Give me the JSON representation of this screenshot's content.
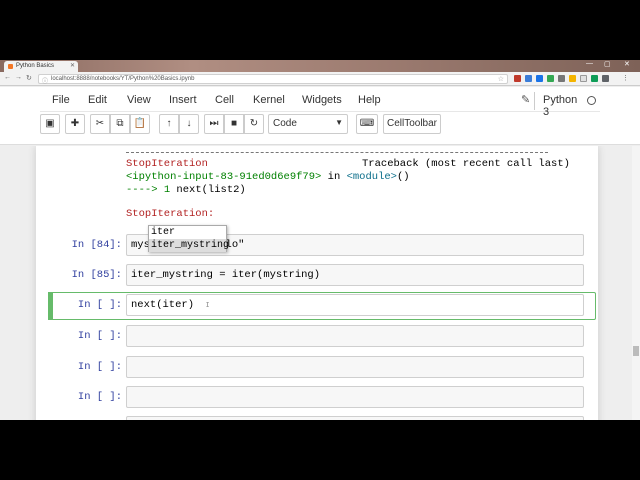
{
  "browser": {
    "tab_title": "Python Basics",
    "address": "localhost:8888/notebooks/YT/Python%20Basics.ipynb",
    "win_minimize": "—",
    "win_maximize": "▢",
    "win_close": "✕"
  },
  "menu": {
    "items": [
      "File",
      "Edit",
      "View",
      "Insert",
      "Cell",
      "Kernel",
      "Widgets",
      "Help"
    ],
    "kernel_name": "Python 3"
  },
  "toolbar": {
    "cell_type": "Code",
    "celltoolbar_label": "CellToolbar"
  },
  "traceback": {
    "error_name": "StopIteration",
    "header_right": "Traceback (most recent call last)",
    "location_prefix": "<ipython-input-83-91ed0d6e9f79>",
    "location_in": " in ",
    "location_module": "<module>",
    "location_suffix": "()",
    "arrow": "---->",
    "line_no": " 1 ",
    "line_code": "next(list2)",
    "final_error": "StopIteration:"
  },
  "cells": [
    {
      "prompt": "In [84]:",
      "code": "mystring = \"Hello\""
    },
    {
      "prompt": "In [85]:",
      "code": "iter_mystring = iter(mystring)"
    },
    {
      "prompt": "In [ ]:",
      "code": "next(iter)"
    },
    {
      "prompt": "In [ ]:",
      "code": ""
    },
    {
      "prompt": "In [ ]:",
      "code": ""
    },
    {
      "prompt": "In [ ]:",
      "code": ""
    }
  ],
  "autocomplete": {
    "options": [
      "iter",
      "iter_mystring"
    ],
    "selected_index": 1
  },
  "colors": {
    "selected_cell": "#66bb6a",
    "prompt": "#303f9f",
    "error": "#b22222",
    "traceback_green": "#008000"
  }
}
